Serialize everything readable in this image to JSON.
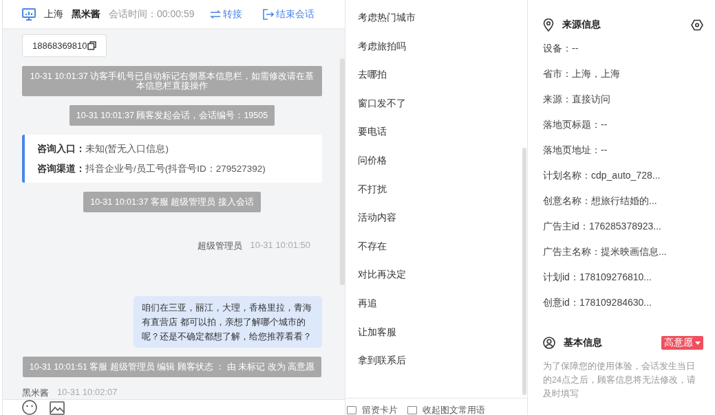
{
  "header": {
    "city": "上海",
    "name": "黑米酱",
    "timer": "会话时间：00:00:59",
    "actions": [
      {
        "kind": "transfer",
        "label": "转接"
      },
      {
        "kind": "end",
        "label": "结束会话"
      }
    ]
  },
  "messages": [
    {
      "kind": "phone",
      "text": "18868369810"
    },
    {
      "kind": "system",
      "text": "10-31 10:01:37 访客手机号已自动标记右侧基本信息栏，如需修改请在基本信息栏直接操作"
    },
    {
      "kind": "system",
      "text": "10-31 10:01:37 顾客发起会话，会话编号：19505"
    },
    {
      "kind": "entry",
      "rows": [
        {
          "label": "咨询入口：",
          "value": "未知(暂无入口信息)"
        },
        {
          "label": "咨询渠道：",
          "value": "抖音企业号/员工号(抖音号ID：279527392)"
        }
      ]
    },
    {
      "kind": "system",
      "text": "10-31 10:01:37 客服 超级管理员 接入会话"
    },
    {
      "kind": "agent",
      "sender": "超级管理员",
      "time": "10-31 10:01:50",
      "text": "咱们在三亚，丽江，大理，香格里拉，青海有直营店 都可以拍，亲想了解哪个城市的呢？还是不确定都想了解，给您推荐看看？"
    },
    {
      "kind": "system",
      "text": "10-31 10:01:51 客服 超级管理员 编辑 顾客状态 ： 由 未标记 改为 高意愿"
    },
    {
      "kind": "customer",
      "sender": "黑米酱",
      "time": "10-31 10:02:07"
    }
  ],
  "quick_replies": [
    "考虑热门城市",
    "考虑旅拍吗",
    "去哪拍",
    "窗口发不了",
    "要电话",
    "问价格",
    "不打扰",
    "活动内容",
    "不存在",
    "对比再决定",
    "再追",
    "让加客服",
    "拿到联系后"
  ],
  "options": [
    {
      "label": "留资卡片",
      "checked": false
    },
    {
      "label": "收起图文常用语",
      "checked": false
    }
  ],
  "source_info": {
    "title": "来源信息",
    "fields": [
      "设备：--",
      "省市：上海，上海",
      "来源：直接访问",
      "落地页标题：--",
      "落地页地址：--",
      "计划名称：cdp_auto_728...",
      "创意名称：想旅行结婚的...",
      "广告主id：176285378923...",
      "广告主名称：提米映画信息...",
      "计划id：178109276810...",
      "创意id：178109284630..."
    ]
  },
  "basic_info": {
    "title": "基本信息",
    "status": "高意愿",
    "notice": "为了保障您的使用体验，会话发生当日的24点之后，顾客信息将无法修改，请及时填写"
  }
}
